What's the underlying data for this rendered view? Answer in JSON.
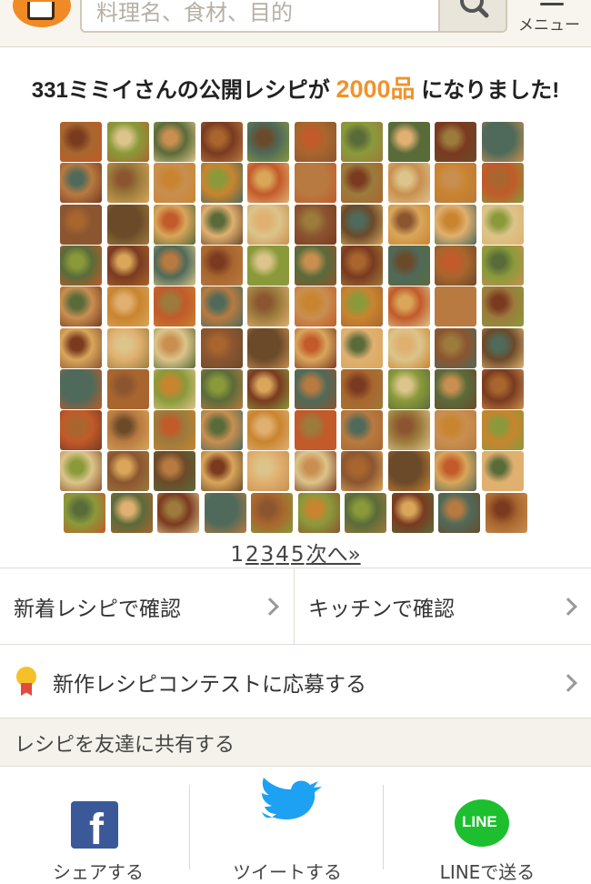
{
  "header": {
    "search_placeholder": "料理名、食材、目的",
    "menu_label": "メニュー"
  },
  "announcement": {
    "prefix": "331ミミイさんの公開レシピが",
    "count": "2000品",
    "suffix": "になりました!"
  },
  "photo_grid": {
    "rows": 10,
    "cols": 10,
    "last_row_count": 10,
    "palette": [
      "#a8662e",
      "#c9842f",
      "#6b4a2a",
      "#8a9a3a",
      "#c25a2a",
      "#d9a65a",
      "#5a6b3a",
      "#b87a40",
      "#e0b070",
      "#7a3a20",
      "#9c7b3c",
      "#dcc48a",
      "#4f6a5a",
      "#c98f50",
      "#8b5530"
    ]
  },
  "pagination": {
    "pages": [
      "1",
      "2",
      "3",
      "4",
      "5"
    ],
    "current": "1",
    "next_label": "次へ»"
  },
  "links": {
    "new_recipes": "新着レシピで確認",
    "kitchen": "キッチンで確認",
    "contest": "新作レシピコンテストに応募する"
  },
  "share": {
    "header": "レシピを友達に共有する",
    "facebook_label": "シェアする",
    "twitter_label": "ツイートする",
    "line_label": "LINEで送る",
    "line_badge": "LINE"
  },
  "colors": {
    "accent": "#f0932b",
    "facebook": "#3b5998",
    "twitter": "#1da1f2",
    "line": "#1dbf2f"
  }
}
